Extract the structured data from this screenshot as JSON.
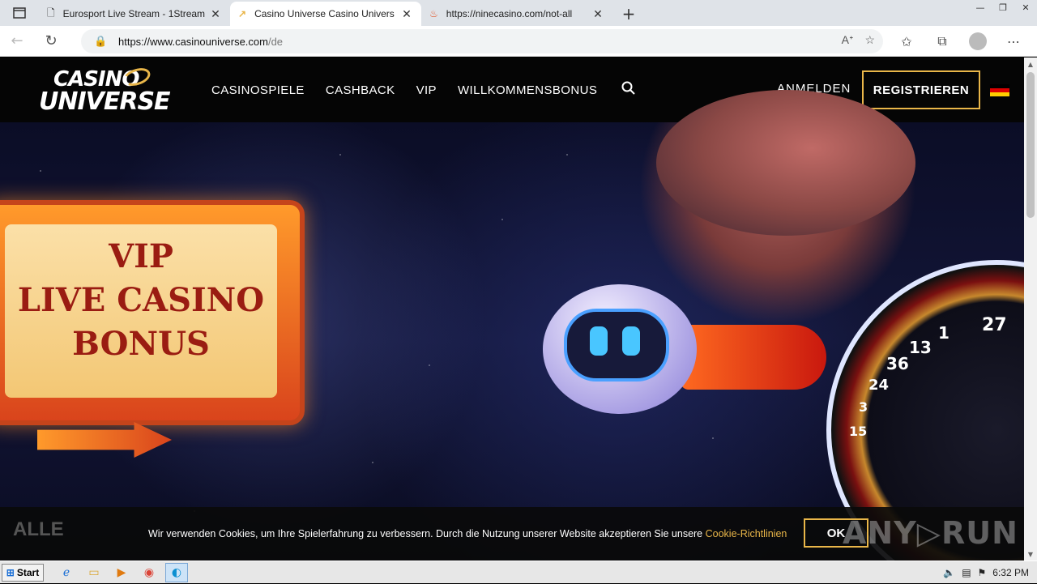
{
  "browser": {
    "tabs": [
      {
        "title": "Eurosport Live Stream - 1Stream",
        "icon": "page-icon",
        "active": false
      },
      {
        "title": "Casino Universe Casino Univers",
        "icon": "casino-universe-favicon",
        "active": true
      },
      {
        "title": "https://ninecasino.com/not-all",
        "icon": "flame-favicon",
        "active": false
      }
    ],
    "new_tab": "+",
    "url_host": "https://www.casinouniverse.com",
    "url_path": "/de"
  },
  "site": {
    "logo_line1": "CASINO",
    "logo_line2": "UNIVERSE",
    "nav": [
      "CASINOSPIELE",
      "CASHBACK",
      "VIP",
      "WILLKOMMENSBONUS"
    ],
    "login": "ANMELDEN",
    "register": "REGISTRIEREN",
    "flag_colors": [
      "#000000",
      "#dd0000",
      "#ffce00"
    ]
  },
  "hero": {
    "billboard_line1": "VIP",
    "billboard_line2": "LIVE CASINO",
    "billboard_line3": "BONUS",
    "roulette_numbers": [
      "27",
      "1",
      "13",
      "36",
      "24",
      "3",
      "15"
    ]
  },
  "cookie": {
    "category": "ALLE",
    "text": "Wir verwenden Cookies, um Ihre Spielerfahrung zu verbessern. Durch die Nutzung unserer Website akzeptieren Sie unsere ",
    "link": "Cookie-Richtlinien",
    "ok": "OK"
  },
  "watermark": "ANY▷RUN",
  "taskbar": {
    "start": "Start",
    "clock": "6:32 PM"
  }
}
